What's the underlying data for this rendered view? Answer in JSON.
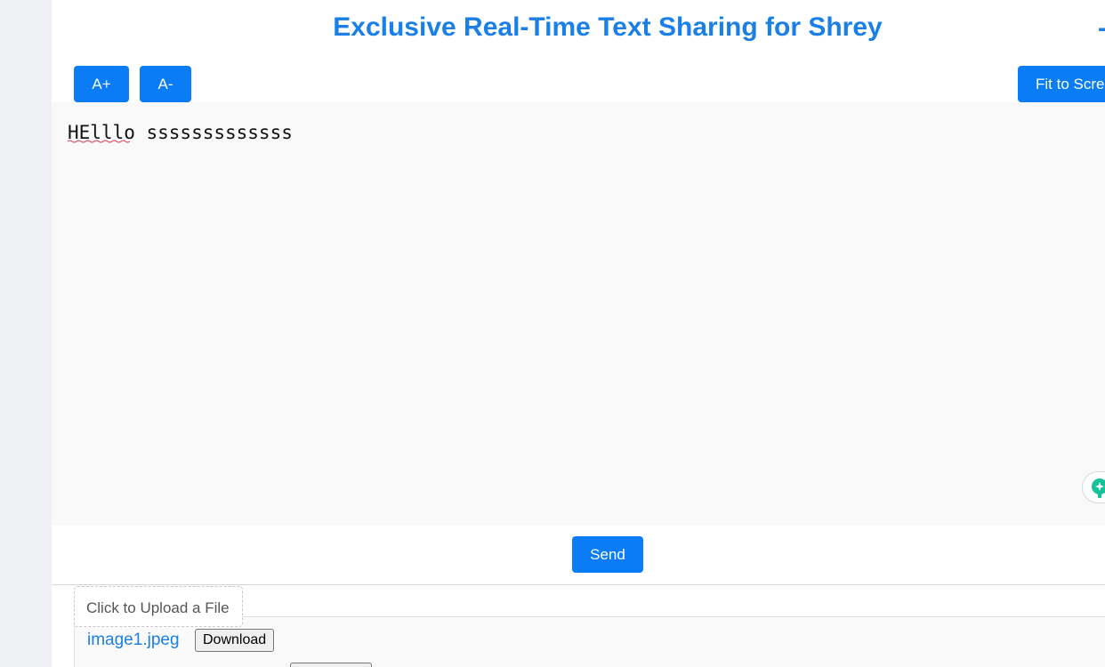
{
  "header": {
    "title": "Exclusive Real-Time Text Sharing for Shrey",
    "corner_mark": "-"
  },
  "toolbar": {
    "font_increase_label": "A+",
    "font_decrease_label": "A-",
    "fit_to_screen_label": "Fit to Scre"
  },
  "editor": {
    "value": "HElllo sssssssssssss",
    "grammar_icon": "grammar-assistant-icon"
  },
  "actions": {
    "send_label": "Send"
  },
  "upload": {
    "label": "Click to Upload a File"
  },
  "files": [
    {
      "name": "image1.jpeg",
      "download_label": "Download"
    }
  ],
  "colors": {
    "accent": "#0a7cf5",
    "title": "#1a7fe6",
    "link": "#1a7fe6",
    "editor_bg": "#f9f9f9",
    "grammar_icon": "#15c39a"
  }
}
